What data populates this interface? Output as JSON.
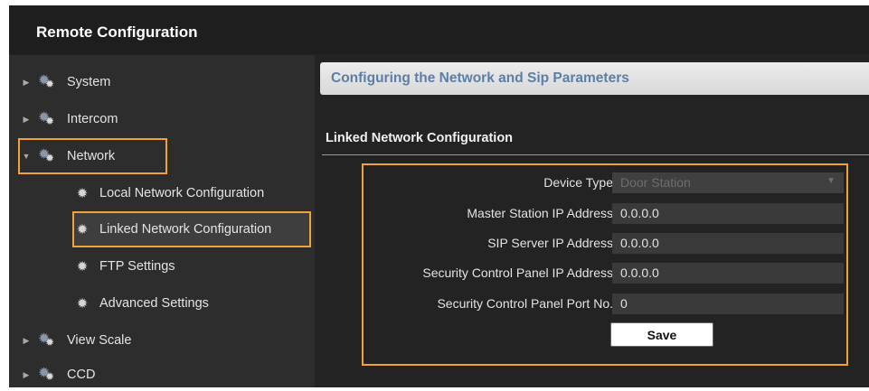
{
  "window": {
    "title": "Remote Configuration"
  },
  "sidebar": {
    "items": [
      {
        "label": "System",
        "icon": "gears-icon",
        "expanded": false
      },
      {
        "label": "Intercom",
        "icon": "gears-icon",
        "expanded": false
      },
      {
        "label": "Network",
        "icon": "gears-icon",
        "expanded": true,
        "children": [
          {
            "label": "Local Network Configuration",
            "icon": "gear-icon"
          },
          {
            "label": "Linked Network Configuration",
            "icon": "gear-icon",
            "selected": true
          },
          {
            "label": "FTP Settings",
            "icon": "gear-icon"
          },
          {
            "label": "Advanced Settings",
            "icon": "gear-icon"
          }
        ]
      },
      {
        "label": "View Scale",
        "icon": "gears-icon",
        "expanded": false
      },
      {
        "label": "CCD",
        "icon": "gears-icon",
        "expanded": false
      }
    ]
  },
  "main": {
    "header": "Configuring the Network and Sip Parameters",
    "section_title": "Linked Network Configuration",
    "form": {
      "device_type": {
        "label": "Device Type",
        "value": "Door Station"
      },
      "master_station_ip": {
        "label": "Master Station IP Address",
        "value": "0.0.0.0"
      },
      "sip_server_ip": {
        "label": "SIP Server IP Address",
        "value": "0.0.0.0"
      },
      "security_panel_ip": {
        "label": "Security Control Panel IP Address",
        "value": "0.0.0.0"
      },
      "security_panel_port": {
        "label": "Security Control Panel Port No.",
        "value": "0"
      }
    },
    "save_label": "Save"
  },
  "colors": {
    "highlight": "#f2a23b",
    "header_text": "#5b7fa6",
    "background": "#232323",
    "sidebar": "#2d2d2d"
  }
}
